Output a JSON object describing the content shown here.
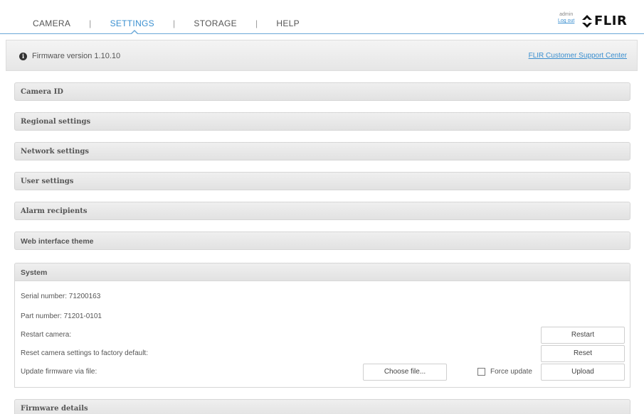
{
  "nav": {
    "tabs": [
      {
        "label": "CAMERA"
      },
      {
        "label": "SETTINGS"
      },
      {
        "label": "STORAGE"
      },
      {
        "label": "HELP"
      }
    ],
    "separator": "|",
    "user": {
      "name": "admin",
      "logout": "Log out"
    },
    "logo": "FLIR"
  },
  "firmware": {
    "version_text": "Firmware version 1.10.10",
    "support_link": "FLIR Customer Support Center"
  },
  "sections": {
    "camera_id": "Camera ID",
    "regional": "Regional settings",
    "network": "Network settings",
    "user": "User settings",
    "alarm": "Alarm recipients",
    "theme": "Web interface theme",
    "system": "System",
    "firmware_details": "Firmware details"
  },
  "system": {
    "serial": "Serial number: 71200163",
    "part": "Part number: 71201-0101",
    "restart_label": "Restart camera:",
    "restart_button": "Restart",
    "reset_label": "Reset camera settings to factory default:",
    "reset_button": "Reset",
    "update_label": "Update firmware via file:",
    "choose_file_button": "Choose file...",
    "force_update_label": "Force update",
    "force_update_checked": false,
    "upload_button": "Upload"
  },
  "colors": {
    "accent": "#3a8fd0",
    "nav_line": "#6aa8d8",
    "section_bg": "#e6e6e6"
  }
}
